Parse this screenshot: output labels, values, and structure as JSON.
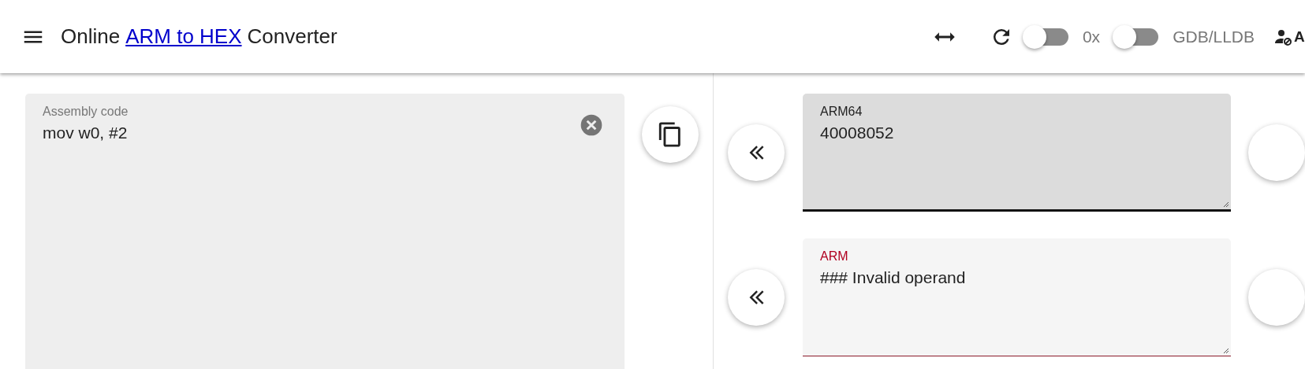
{
  "header": {
    "title_prefix": "Online",
    "title_link": "ARM to HEX",
    "title_suffix": "Converter",
    "toggles": [
      {
        "label": "0x",
        "on": false
      },
      {
        "label": "GDB/LLDB",
        "on": false
      }
    ],
    "account_label": "A"
  },
  "input": {
    "label": "Assembly code",
    "value": "mov w0, #2"
  },
  "outputs": [
    {
      "label": "ARM64",
      "value": "40008052",
      "focused": true,
      "error": false
    },
    {
      "label": "ARM",
      "value": "### Invalid operand",
      "focused": false,
      "error": true
    }
  ]
}
